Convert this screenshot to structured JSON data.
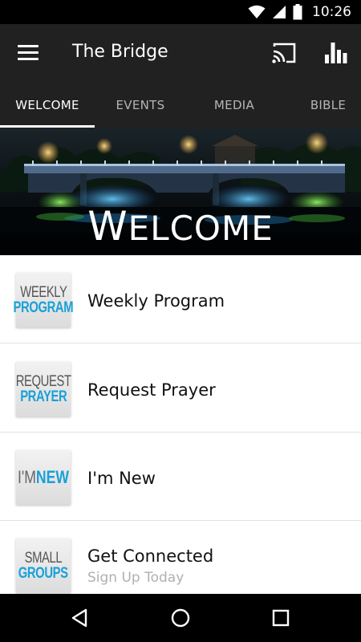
{
  "status_bar": {
    "time": "10:26",
    "icons": [
      "wifi-icon",
      "cell-signal-icon",
      "battery-icon"
    ]
  },
  "app_bar": {
    "title": "The Bridge",
    "icons": [
      "menu-icon",
      "cast-icon",
      "bar-chart-icon"
    ]
  },
  "tabs": [
    {
      "label": "WELCOME",
      "active": true
    },
    {
      "label": "EVENTS",
      "active": false
    },
    {
      "label": "MEDIA",
      "active": false
    },
    {
      "label": "BIBLE",
      "active": false
    }
  ],
  "banner": {
    "first_letter": "W",
    "rest": "ELCOME"
  },
  "list": [
    {
      "title": "Weekly Program",
      "subtitle": "",
      "thumb": [
        "WEEKLY",
        "PROGRAM"
      ]
    },
    {
      "title": "Request Prayer",
      "subtitle": "",
      "thumb": [
        "REQUEST",
        "PRAYER"
      ]
    },
    {
      "title": "I'm New",
      "subtitle": "",
      "thumb": [
        "I'M",
        "NEW"
      ]
    },
    {
      "title": "Get Connected",
      "subtitle": "Sign Up Today",
      "thumb": [
        "SMALL",
        "GROUPS"
      ]
    }
  ],
  "nav_bar": {
    "icons": [
      "back-icon",
      "home-icon",
      "recents-icon"
    ]
  },
  "colors": {
    "app_bar": "#212121",
    "accent_blue": "#1aa0d8"
  }
}
